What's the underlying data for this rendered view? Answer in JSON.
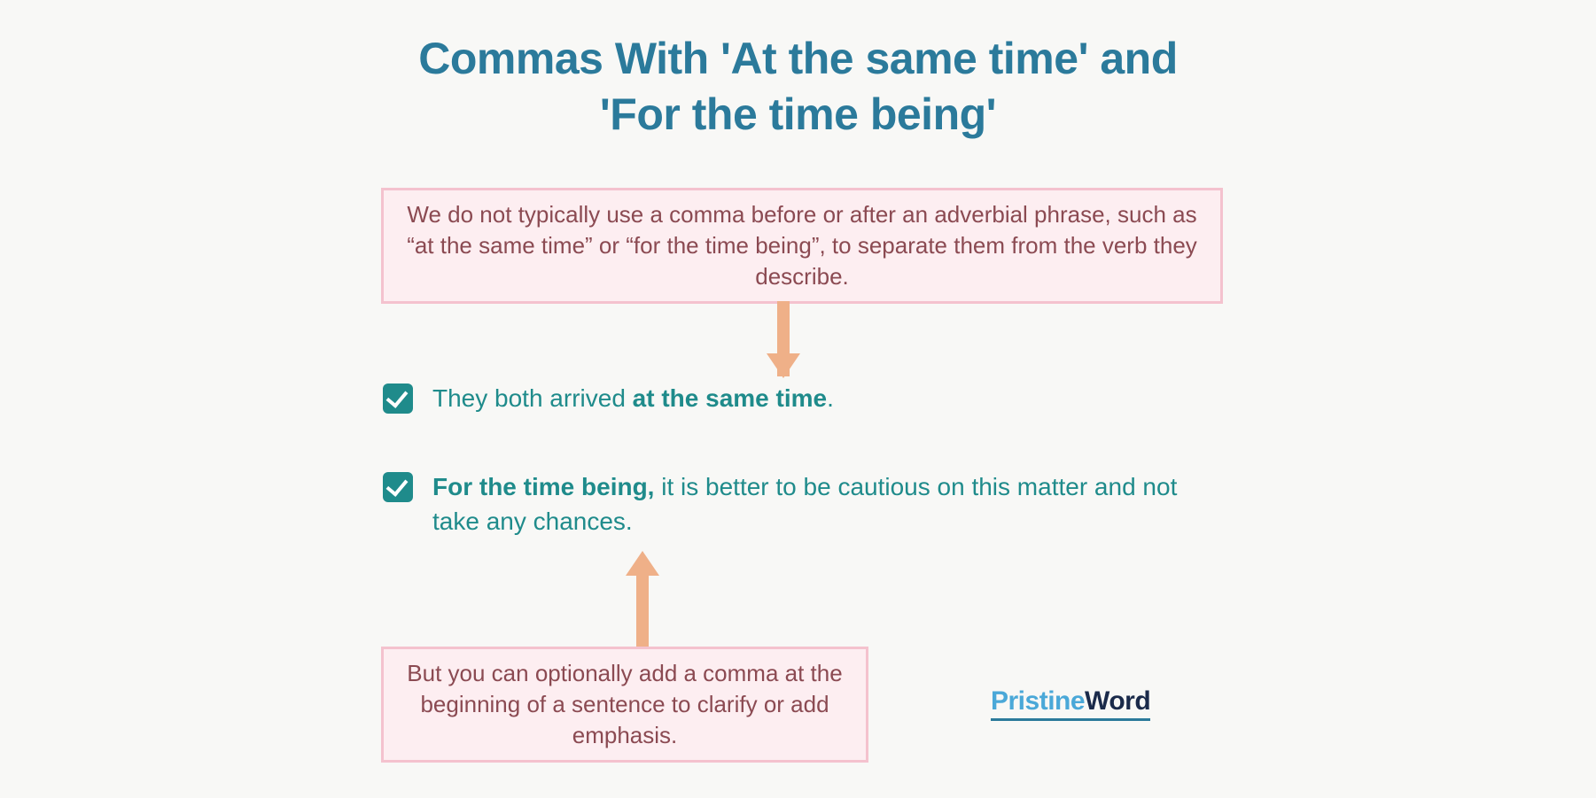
{
  "title_line1": "Commas With 'At the same time' and",
  "title_line2": "'For the time being'",
  "rule1": "We do not typically use a comma before or after an adverbial phrase, such as “at the same time” or “for the time being”, to separate them from the verb they describe.",
  "rule2": "But you can optionally add a comma at the beginning of a sentence to clarify or add emphasis.",
  "example1": {
    "prefix": "They both arrived ",
    "bold": "at the same time",
    "suffix": "."
  },
  "example2": {
    "bold": "For the time being,",
    "suffix": " it is better to be cautious on this matter and not take any chances."
  },
  "logo": {
    "part1": "Pristine",
    "part2": "Word"
  }
}
